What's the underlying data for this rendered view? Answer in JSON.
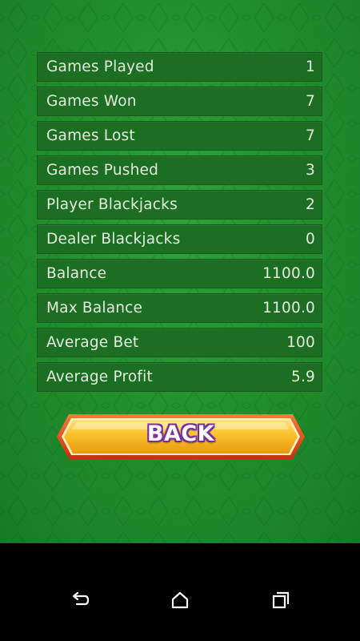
{
  "stats": [
    {
      "label": "Games Played",
      "value": "1"
    },
    {
      "label": "Games Won",
      "value": "7"
    },
    {
      "label": "Games Lost",
      "value": "7"
    },
    {
      "label": "Games Pushed",
      "value": "3"
    },
    {
      "label": "Player Blackjacks",
      "value": "2"
    },
    {
      "label": "Dealer Blackjacks",
      "value": "0"
    },
    {
      "label": "Balance",
      "value": "1100.0"
    },
    {
      "label": "Max Balance",
      "value": "1100.0"
    },
    {
      "label": "Average Bet",
      "value": "100"
    },
    {
      "label": "Average Profit",
      "value": "5.9"
    }
  ],
  "back_button": {
    "label": "BACK"
  },
  "nav": {
    "back_icon": "back-arrow-icon",
    "home_icon": "home-icon",
    "recents_icon": "recent-apps-icon"
  },
  "colors": {
    "felt": "#22902f",
    "row_bg": "#1c6f22",
    "button_gold": "#f5b71a",
    "button_outline": "#e24a1b",
    "label_outline": "#7b2f9c"
  }
}
